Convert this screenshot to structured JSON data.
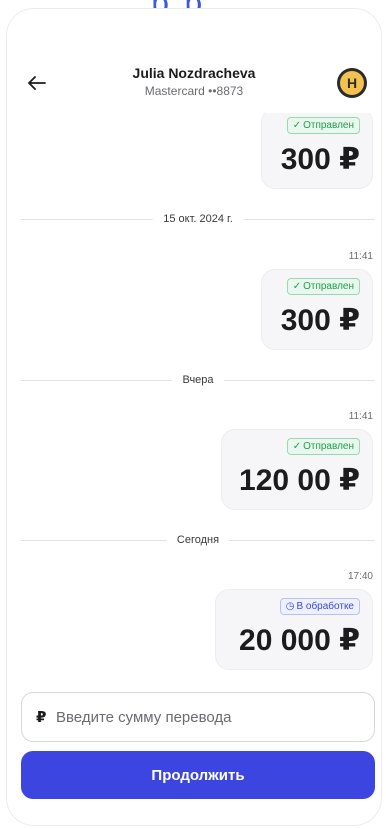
{
  "header": {
    "contact_name": "Julia Nozdracheva",
    "card_label": "Mastercard ••8873",
    "avatar_letter": "H"
  },
  "messages": [
    {
      "status": "Отправлен",
      "status_type": "sent",
      "amount": "300 ₽"
    },
    {
      "time": "11:41",
      "status": "Отправлен",
      "status_type": "sent",
      "amount": "300 ₽"
    },
    {
      "time": "11:41",
      "status": "Отправлен",
      "status_type": "sent",
      "amount": "120 00 ₽"
    },
    {
      "time": "17:40",
      "status": "В обработке",
      "status_type": "pending",
      "amount": "20 000 ₽"
    }
  ],
  "dividers": [
    "15 окт. 2024 г.",
    "Вчера",
    "Сегодня"
  ],
  "input": {
    "currency_symbol": "₽",
    "placeholder": "Введите сумму перевода",
    "value": ""
  },
  "continue_label": "Продолжить",
  "colors": {
    "accent": "#3c45e0",
    "sent_green": "#1f9d49",
    "pending_blue": "#3b4bd8"
  }
}
